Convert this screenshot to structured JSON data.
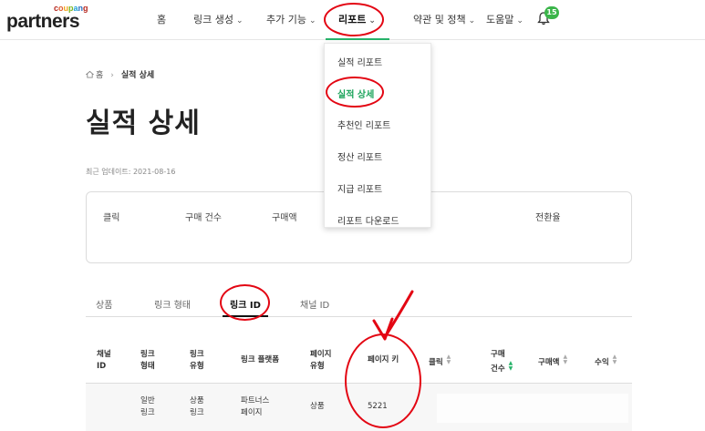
{
  "logo": {
    "brand": "coupang",
    "product": "partners"
  },
  "nav": {
    "home": "홈",
    "link_create": "링크 생성",
    "extra": "추가 기능",
    "report": "리포트",
    "terms": "약관 및 정책",
    "help": "도움말",
    "notifications": "15"
  },
  "dropdown": [
    "실적 리포트",
    "실적 상세",
    "추천인 리포트",
    "정산 리포트",
    "지급 리포트",
    "리포트 다운로드"
  ],
  "breadcrumb": {
    "home": "홈",
    "current": "실적 상세"
  },
  "page": {
    "title": "실적 상세",
    "updated": "최근 업데이트: 2021-08-16"
  },
  "summary": {
    "click": "클릭",
    "purchases": "구매 건수",
    "amount": "구매액",
    "conversion": "전환율"
  },
  "tabs": [
    "상품",
    "링크 형태",
    "링크 ID",
    "채널 ID"
  ],
  "table": {
    "headers": {
      "channel_id": [
        "채널",
        "ID"
      ],
      "link_form": [
        "링크",
        "형태"
      ],
      "link_type": [
        "링크",
        "유형"
      ],
      "platform": "링크 플랫폼",
      "page_type": [
        "페이지",
        "유형"
      ],
      "page_key": "페이지 키",
      "click": "클릭",
      "purchases": [
        "구매",
        "건수"
      ],
      "amount": "구매액",
      "revenue": "수익"
    },
    "rows": [
      {
        "channel_id": "",
        "link_form": [
          "일반",
          "링크"
        ],
        "link_type": [
          "상품",
          "링크"
        ],
        "platform": [
          "파트너스",
          "페이지"
        ],
        "page_type": "상품",
        "page_key": "5221"
      }
    ]
  },
  "colors": {
    "accent": "#27b36a",
    "marker": "#e30613",
    "badge": "#3bb54a"
  }
}
